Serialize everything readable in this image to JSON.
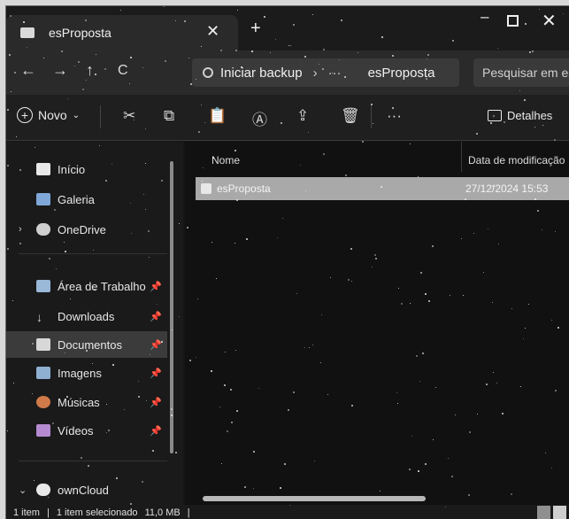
{
  "window": {
    "tab_title": "esProposta",
    "tab_close": "✕",
    "new_tab": "+",
    "minimize": "–",
    "close": "✕"
  },
  "nav": {
    "back": "←",
    "forward": "→",
    "up": "↑",
    "refresh": "C",
    "breadcrumb": [
      "Iniciar backup",
      "esProposta"
    ],
    "separator": "›",
    "more": "···",
    "search_placeholder": "Pesquisar em es"
  },
  "toolbar": {
    "new_label": "Novo",
    "new_chevron": "⌄",
    "cut": "✂",
    "copy": "⧉",
    "paste": "📋",
    "rename": "Ⓐ",
    "share": "⇪",
    "delete": "🗑",
    "more": "···",
    "details_label": "Detalhes"
  },
  "sidebar": {
    "items": [
      {
        "label": "Início",
        "icon": "home-icon",
        "color": "#e8e8e8"
      },
      {
        "label": "Galeria",
        "icon": "gallery-icon",
        "color": "#7fa8d8"
      },
      {
        "label": "OneDrive",
        "icon": "cloud-icon",
        "color": "#cfcfcf"
      },
      {
        "label": "Área de Trabalho",
        "icon": "desktop-icon",
        "color": "#9ab8d8"
      },
      {
        "label": "Downloads",
        "icon": "download-icon",
        "color": "#cfcfcf"
      },
      {
        "label": "Documentos",
        "icon": "documents-icon",
        "color": "#d8d8d8"
      },
      {
        "label": "Imagens",
        "icon": "pictures-icon",
        "color": "#8fb0d0"
      },
      {
        "label": "Músicas",
        "icon": "music-icon",
        "color": "#d07a4a"
      },
      {
        "label": "Vídeos",
        "icon": "videos-icon",
        "color": "#b58ad0"
      },
      {
        "label": "ownCloud",
        "icon": "cloud-icon",
        "color": "#e8e8e8"
      }
    ],
    "expand_glyph": "›",
    "expanded_glyph": "⌄",
    "pin_glyph": "📌"
  },
  "content": {
    "columns": [
      "Nome",
      "Data de modificação"
    ],
    "rows": [
      {
        "name": "esProposta",
        "date": "27/12/2024 15:53"
      }
    ]
  },
  "status": {
    "count": "1 item",
    "divider": "|",
    "selected": "1 item selecionado",
    "size": "11,0 MB"
  }
}
